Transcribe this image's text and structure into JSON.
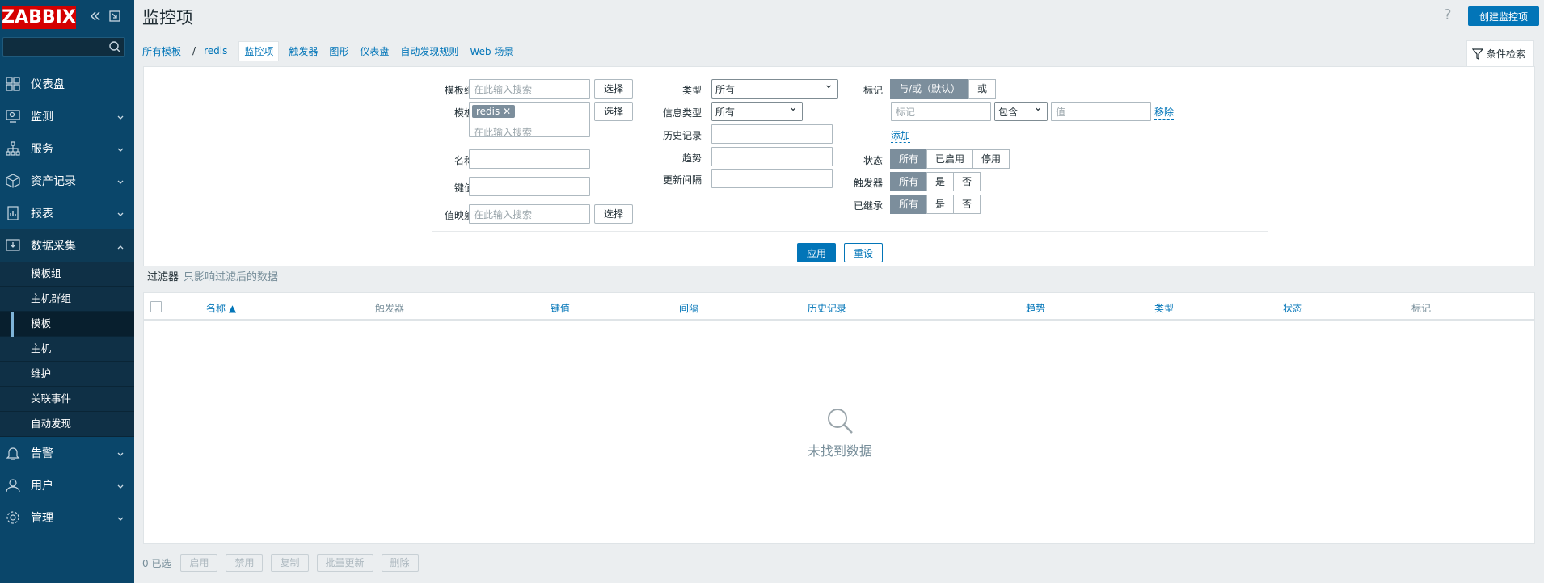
{
  "sidebar": {
    "logo": "ZABBIX",
    "menu": [
      {
        "label": "仪表盘",
        "icon": "dashboard-icon"
      },
      {
        "label": "监测",
        "icon": "monitoring-icon"
      },
      {
        "label": "服务",
        "icon": "services-icon"
      },
      {
        "label": "资产记录",
        "icon": "inventory-icon"
      },
      {
        "label": "报表",
        "icon": "reports-icon"
      },
      {
        "label": "数据采集",
        "icon": "data-collection-icon"
      },
      {
        "label": "告警",
        "icon": "alerts-icon"
      },
      {
        "label": "用户",
        "icon": "users-icon"
      },
      {
        "label": "管理",
        "icon": "administration-icon"
      }
    ],
    "submenu": [
      "模板组",
      "主机群组",
      "模板",
      "主机",
      "维护",
      "关联事件",
      "自动发现"
    ]
  },
  "header": {
    "title": "监控项",
    "help": "?",
    "create_button": "创建监控项"
  },
  "nav": {
    "crumb_all": "所有模板",
    "crumb_sep": "/",
    "crumb_template": "redis",
    "tabs": [
      "监控项",
      "触发器",
      "图形",
      "仪表盘",
      "自动发现规则",
      "Web 场景"
    ],
    "filter_tab": "条件检索"
  },
  "filter": {
    "template_group_label": "模板组",
    "template_label": "模板",
    "name_label": "名称",
    "key_label": "键值",
    "valuemap_label": "值映射",
    "search_placeholder": "在此输入搜索",
    "select_button": "选择",
    "template_tag": "redis",
    "template_tag_remove": "✕",
    "type_label": "类型",
    "type_value": "所有",
    "info_type_label": "信息类型",
    "info_type_value": "所有",
    "history_label": "历史记录",
    "trends_label": "趋势",
    "interval_label": "更新间隔",
    "tags_label": "标记",
    "tags_andor": "与/或（默认）",
    "tags_or": "或",
    "tag_placeholder": "标记",
    "tag_operator": "包含",
    "value_placeholder": "值",
    "remove_link": "移除",
    "add_link": "添加",
    "status_label": "状态",
    "status_options": [
      "所有",
      "已启用",
      "停用"
    ],
    "triggers_label": "触发器",
    "inherited_label": "已继承",
    "yesno_options": [
      "所有",
      "是",
      "否"
    ],
    "apply_button": "应用",
    "reset_button": "重设",
    "note_title": "过滤器",
    "note_sub": "只影响过滤后的数据"
  },
  "table": {
    "columns": [
      "名称 ▲",
      "触发器",
      "键值",
      "间隔",
      "历史记录",
      "趋势",
      "类型",
      "状态",
      "标记"
    ],
    "empty_text": "未找到数据"
  },
  "footer": {
    "selected": "0 已选",
    "buttons": [
      "启用",
      "禁用",
      "复制",
      "批量更新",
      "删除"
    ]
  }
}
